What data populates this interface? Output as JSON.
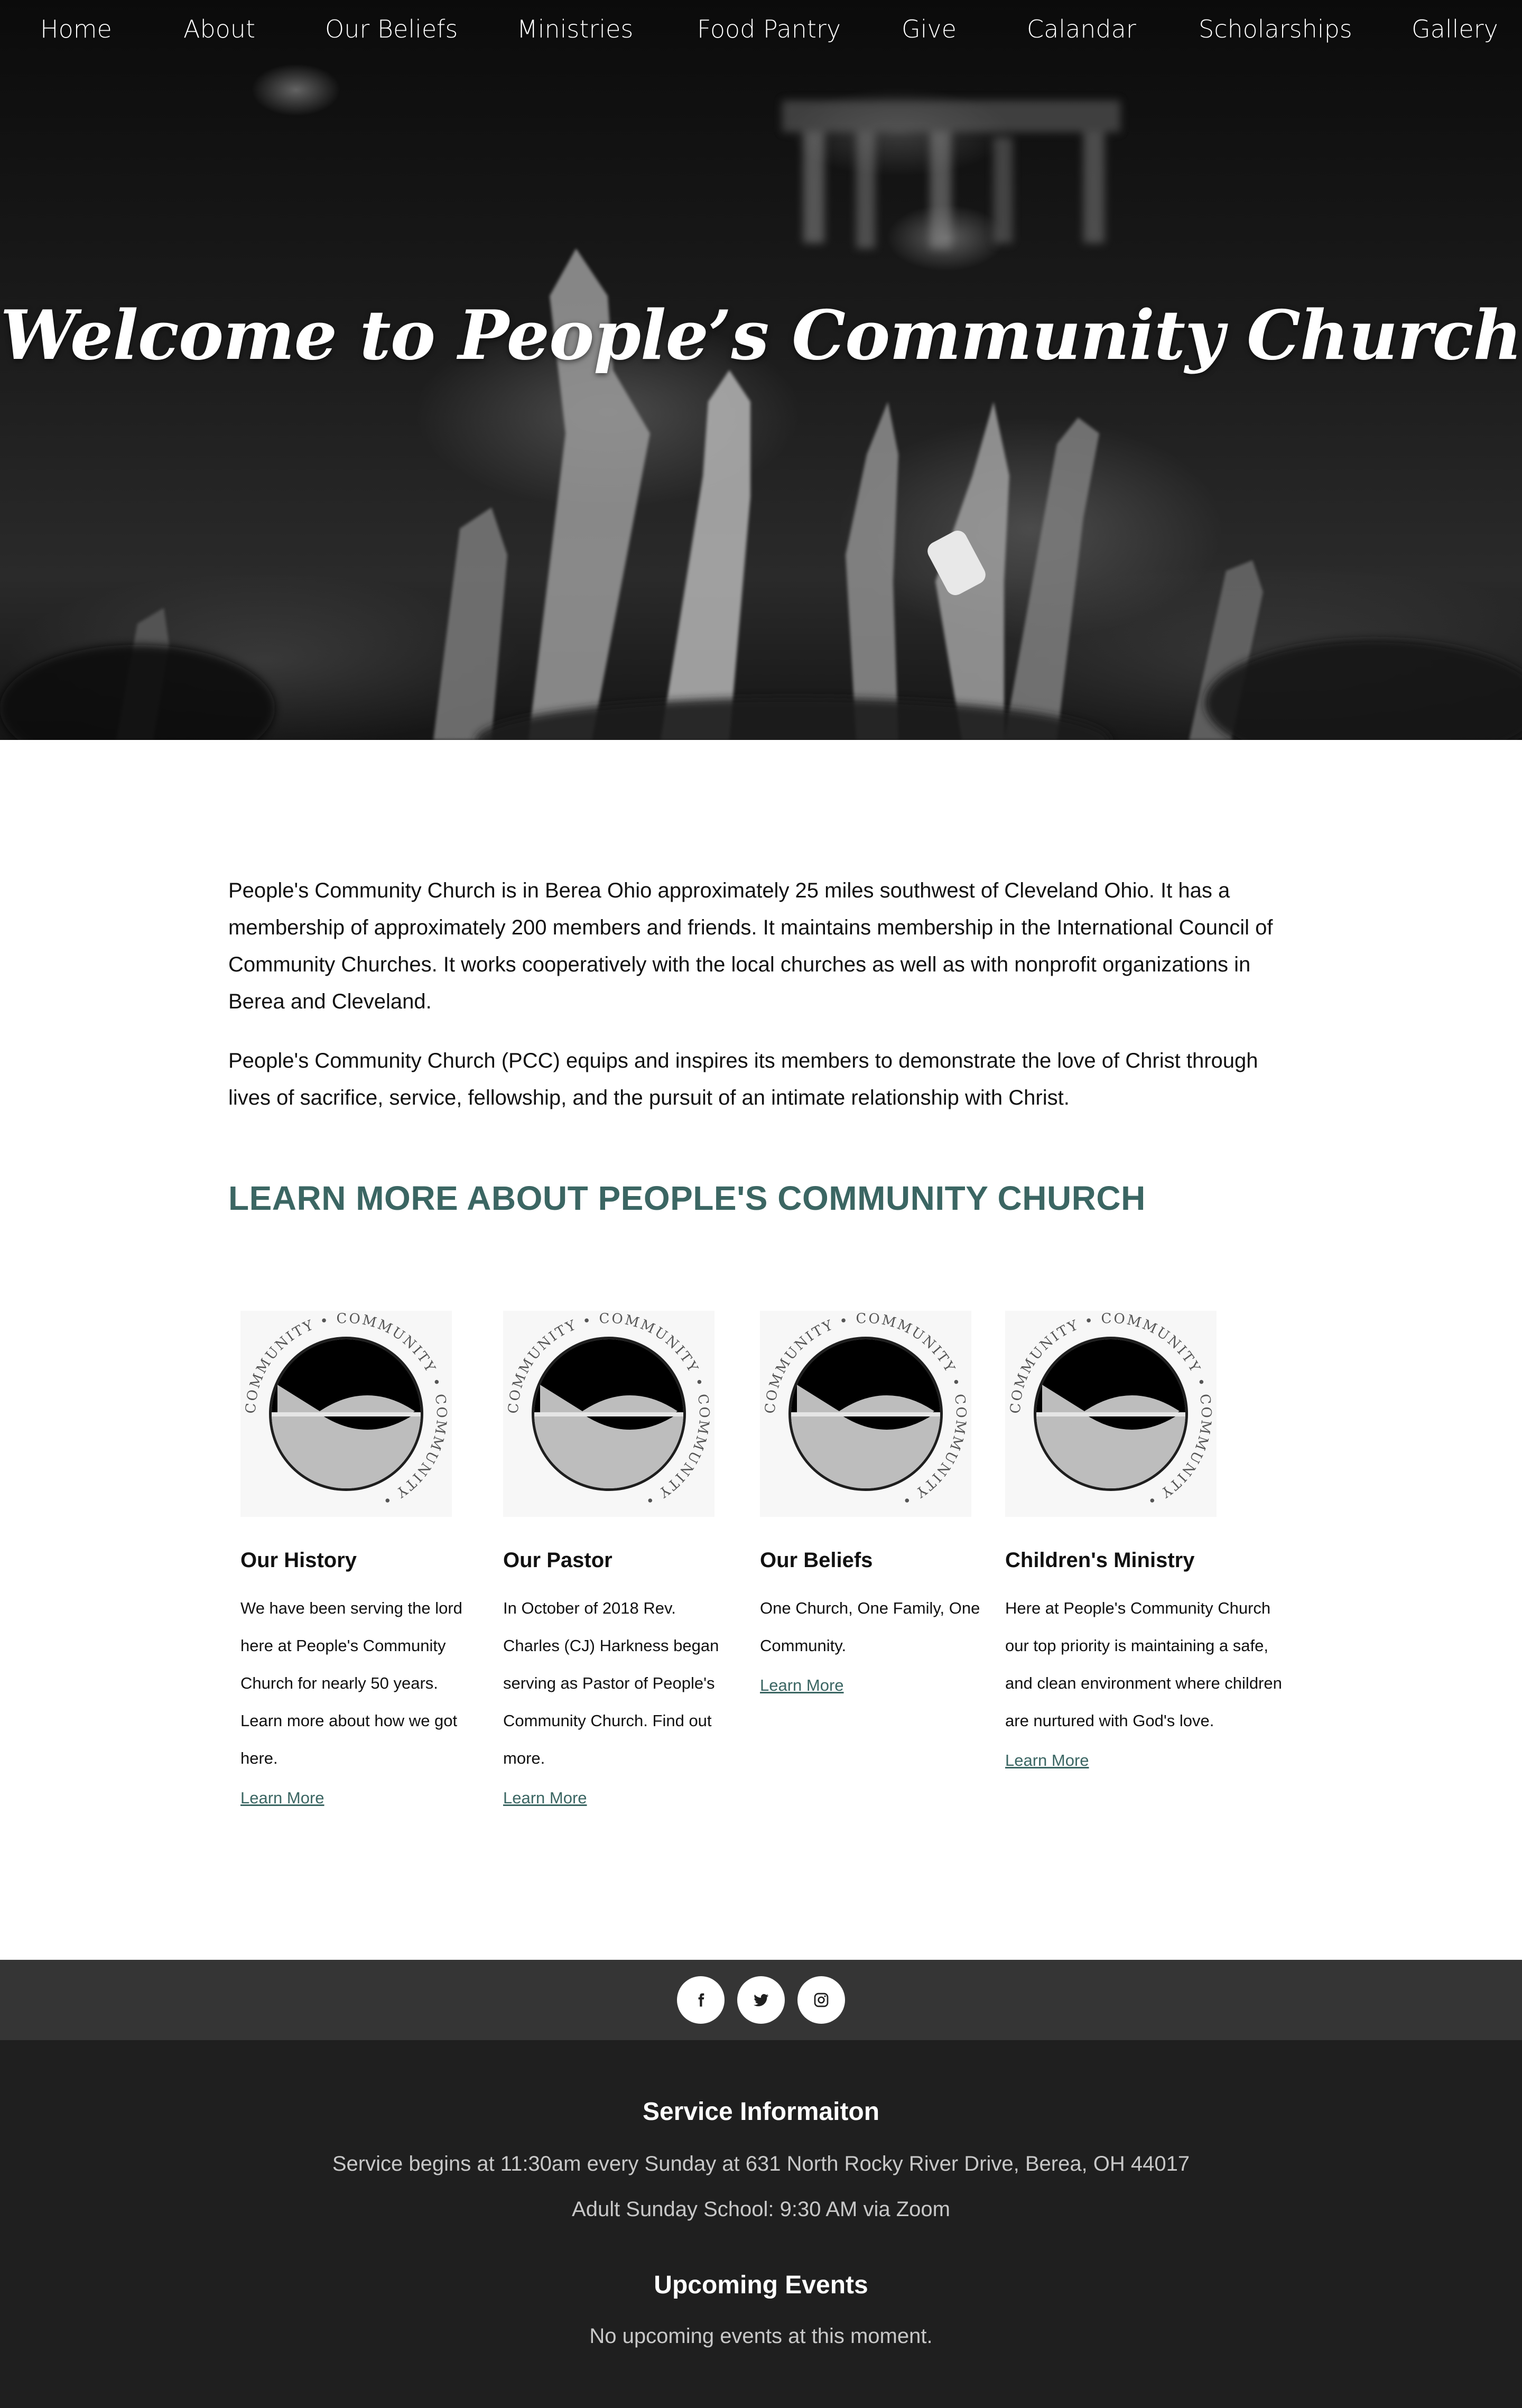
{
  "nav": {
    "items": [
      {
        "label": "Home"
      },
      {
        "label": "About"
      },
      {
        "label": "Our Beliefs"
      },
      {
        "label": "Ministries"
      },
      {
        "label": "Food Pantry"
      },
      {
        "label": "Give"
      },
      {
        "label": "Calandar"
      },
      {
        "label": "Scholarships"
      },
      {
        "label": "Gallery"
      }
    ]
  },
  "hero": {
    "title": "Welcome to People’s Community Church"
  },
  "intro": {
    "paragraphs": [
      "People's Community Church is in Berea Ohio approximately 25 miles southwest of Cleveland Ohio. It has a membership of approximately 200 members and friends. It maintains membership in the International Council of Community Churches. It works cooperatively with the local churches as well as with nonprofit organizations in Berea and Cleveland.",
      "People's Community Church (PCC) equips and inspires its members to demonstrate the love of Christ through lives of sacrifice, service, fellowship, and the pursuit of an intimate relationship with Christ."
    ]
  },
  "learn_more": {
    "heading": "LEARN MORE ABOUT PEOPLE'S COMMUNITY CHURCH",
    "logo_text": "COMMUNITY",
    "cards": [
      {
        "title": "Our History",
        "description": "We have been serving the lord here at People's Community Church for nearly 50 years. Learn more about how we got here.",
        "link": "Learn More"
      },
      {
        "title": "Our Pastor",
        "description": "In October of 2018 Rev. Charles (CJ) Harkness began serving as Pastor of People's Community Church. Find out more.",
        "link": "Learn More"
      },
      {
        "title": "Our Beliefs",
        "description": "One Church, One Family, One Community.",
        "link": "Learn More"
      },
      {
        "title": "Children's Ministry",
        "description": "Here at People's Community Church our top priority is maintaining a safe, and clean environment where children are nurtured with God's love.",
        "link": "Learn More"
      }
    ]
  },
  "social": {
    "icons": [
      "facebook-icon",
      "twitter-icon",
      "instagram-icon"
    ]
  },
  "footer": {
    "service_heading": "Service Informaiton",
    "service_line1": "Service begins at 11:30am every Sunday at 631 North Rocky River Drive, Berea, OH 44017",
    "service_line2": "Adult Sunday School: 9:30 AM via Zoom",
    "events_heading": "Upcoming Events",
    "events_text": "No upcoming events at this moment."
  },
  "colors": {
    "accent": "#3b6663",
    "social_bar": "#353535",
    "footer_bg": "#1f1f1f"
  }
}
